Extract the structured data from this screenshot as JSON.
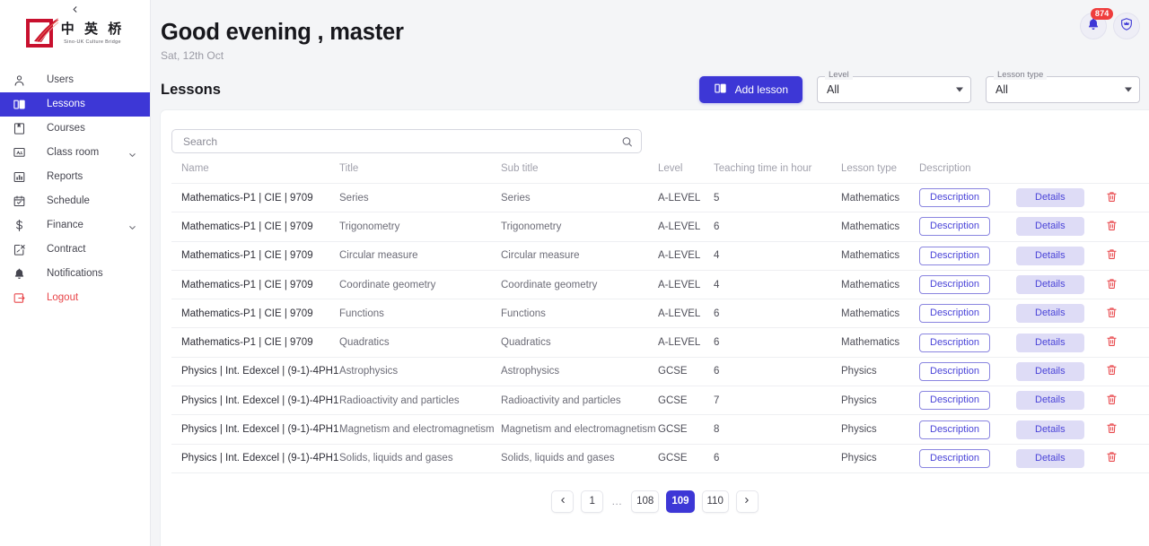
{
  "sidebar": {
    "collapse_icon": "chevron-left-icon",
    "logo": {
      "cn": "中 英 桥",
      "en": "Sino-UK Culture Bridge"
    },
    "items": [
      {
        "label": "Users",
        "icon": "user-icon",
        "active": false,
        "expandable": false
      },
      {
        "label": "Lessons",
        "icon": "book-open-icon",
        "active": true,
        "expandable": false
      },
      {
        "label": "Courses",
        "icon": "bookmark-icon",
        "active": false,
        "expandable": false
      },
      {
        "label": "Class room",
        "icon": "classroom-icon",
        "active": false,
        "expandable": true
      },
      {
        "label": "Reports",
        "icon": "bar-chart-icon",
        "active": false,
        "expandable": false
      },
      {
        "label": "Schedule",
        "icon": "calendar-icon",
        "active": false,
        "expandable": false
      },
      {
        "label": "Finance",
        "icon": "dollar-icon",
        "active": false,
        "expandable": true
      },
      {
        "label": "Contract",
        "icon": "contract-edit-icon",
        "active": false,
        "expandable": false
      },
      {
        "label": "Notifications",
        "icon": "bell-icon",
        "active": false,
        "expandable": false
      },
      {
        "label": "Logout",
        "icon": "logout-icon",
        "active": false,
        "expandable": false,
        "danger": true
      }
    ]
  },
  "header": {
    "greeting": "Good evening , master",
    "date": "Sat, 12th Oct",
    "notifications": {
      "icon": "bell-icon",
      "badge": "874"
    },
    "account": {
      "icon": "shield-crown-icon"
    }
  },
  "toolbar": {
    "page_title": "Lessons",
    "add_label": "Add lesson",
    "add_icon": "book-open-icon",
    "level_filter": {
      "label": "Level",
      "value": "All"
    },
    "type_filter": {
      "label": "Lesson type",
      "value": "All"
    }
  },
  "search": {
    "placeholder": "Search",
    "value": "",
    "icon": "search-icon"
  },
  "table": {
    "columns": [
      "Name",
      "Title",
      "Sub title",
      "Level",
      "Teaching time in hour",
      "Lesson type",
      "Description",
      ""
    ],
    "row_actions": {
      "description": "Description",
      "details": "Details",
      "delete_icon": "trash-icon"
    },
    "rows": [
      {
        "name": "Mathematics-P1 | CIE | 9709",
        "title": "Series",
        "subtitle": "Series",
        "level": "A-LEVEL",
        "time": "5",
        "type": "Mathematics"
      },
      {
        "name": "Mathematics-P1 | CIE | 9709",
        "title": "Trigonometry",
        "subtitle": "Trigonometry",
        "level": "A-LEVEL",
        "time": "6",
        "type": "Mathematics"
      },
      {
        "name": "Mathematics-P1 | CIE | 9709",
        "title": "Circular measure",
        "subtitle": "Circular measure",
        "level": "A-LEVEL",
        "time": "4",
        "type": "Mathematics"
      },
      {
        "name": "Mathematics-P1 | CIE | 9709",
        "title": "Coordinate geometry",
        "subtitle": "Coordinate geometry",
        "level": "A-LEVEL",
        "time": "4",
        "type": "Mathematics"
      },
      {
        "name": "Mathematics-P1 | CIE | 9709",
        "title": "Functions",
        "subtitle": "Functions",
        "level": "A-LEVEL",
        "time": "6",
        "type": "Mathematics"
      },
      {
        "name": "Mathematics-P1 | CIE | 9709",
        "title": "Quadratics",
        "subtitle": "Quadratics",
        "level": "A-LEVEL",
        "time": "6",
        "type": "Mathematics"
      },
      {
        "name": "Physics | Int. Edexcel | (9-1)-4PH1",
        "title": "Astrophysics",
        "subtitle": "Astrophysics",
        "level": "GCSE",
        "time": "6",
        "type": "Physics"
      },
      {
        "name": "Physics | Int. Edexcel | (9-1)-4PH1",
        "title": "Radioactivity and particles",
        "subtitle": "Radioactivity and particles",
        "level": "GCSE",
        "time": "7",
        "type": "Physics"
      },
      {
        "name": "Physics | Int. Edexcel | (9-1)-4PH1",
        "title": "Magnetism and electromagnetism",
        "subtitle": "Magnetism and electromagnetism",
        "level": "GCSE",
        "time": "8",
        "type": "Physics"
      },
      {
        "name": "Physics | Int. Edexcel | (9-1)-4PH1",
        "title": "Solids, liquids and gases",
        "subtitle": "Solids, liquids and gases",
        "level": "GCSE",
        "time": "6",
        "type": "Physics"
      }
    ]
  },
  "pagination": {
    "prev_icon": "chevron-left-icon",
    "next_icon": "chevron-right-icon",
    "pages": [
      "1",
      "…",
      "108",
      "109",
      "110"
    ],
    "current": "109"
  },
  "colors": {
    "accent": "#3d37d6",
    "accent_soft": "#dedcf6",
    "danger": "#e8464a",
    "badge": "#ef3d3d",
    "page_bg": "#f4f5f7"
  }
}
